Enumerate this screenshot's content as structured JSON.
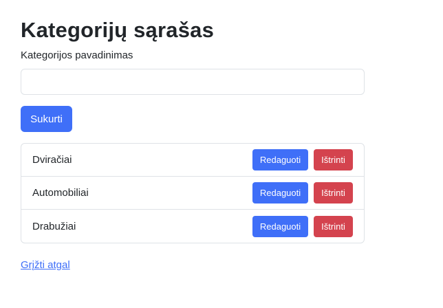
{
  "page": {
    "title": "Kategorijų sąrašas"
  },
  "form": {
    "name_label": "Kategorijos pavadinimas",
    "name_value": "",
    "create_label": "Sukurti"
  },
  "categories": [
    {
      "name": "Dviračiai",
      "edit_label": "Redaguoti",
      "delete_label": "Ištrinti"
    },
    {
      "name": "Automobiliai",
      "edit_label": "Redaguoti",
      "delete_label": "Ištrinti"
    },
    {
      "name": "Drabužiai",
      "edit_label": "Redaguoti",
      "delete_label": "Ištrinti"
    }
  ],
  "back_link": {
    "label": "Grįžti atgal"
  },
  "colors": {
    "primary": "#3f6ff8",
    "danger": "#d4434e",
    "border": "#dee2e6",
    "text": "#212529"
  }
}
